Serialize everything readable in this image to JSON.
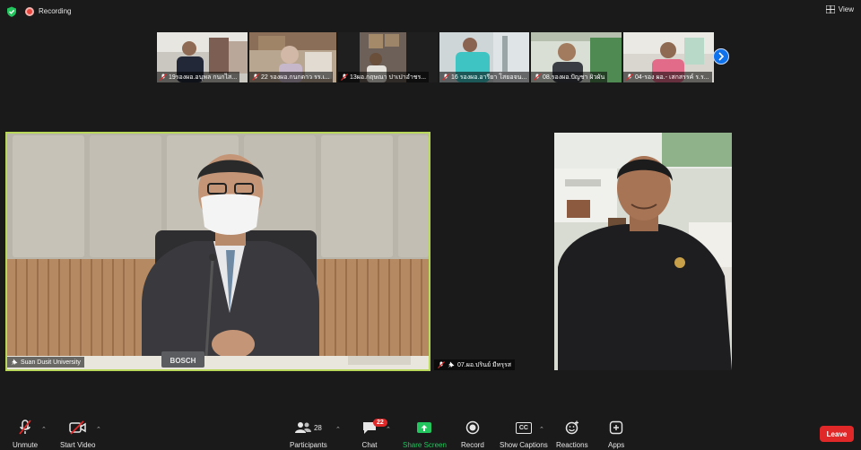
{
  "topbar": {
    "recording_label": "Recording",
    "view_label": "View"
  },
  "thumbnails": [
    {
      "name": "19รองผอ.อนุพล  กนกไส..."
    },
    {
      "name": "22 รองผอ.กนกดาว รร.เ..."
    },
    {
      "name": "13ผอ.กฤษณา ปาเปาอำชร..."
    },
    {
      "name": "16 รองผอ.อารียา  โสยอจน..."
    },
    {
      "name": "08.รองผอ.ปัญชา  ผิวผัน"
    },
    {
      "name": "04-รอง ผอ.- เสกสรรค์ ร.ร..."
    }
  ],
  "main_videos": {
    "left_name": "Suan Dusit University",
    "right_name": "07.ผอ.ปรินย์ มีทรุรส",
    "mic_brand": "BOSCH"
  },
  "toolbar": {
    "unmute": "Unmute",
    "start_video": "Start Video",
    "participants": "Participants",
    "participants_count": "28",
    "chat": "Chat",
    "chat_badge": "22",
    "share_screen": "Share Screen",
    "record": "Record",
    "show_captions": "Show Captions",
    "captions_icon_text": "CC",
    "reactions": "Reactions",
    "apps": "Apps",
    "leave": "Leave"
  },
  "colors": {
    "accent_blue": "#0e72ed",
    "share_green": "#22c55e",
    "leave_red": "#e02828",
    "active_border": "#b9d75a"
  }
}
